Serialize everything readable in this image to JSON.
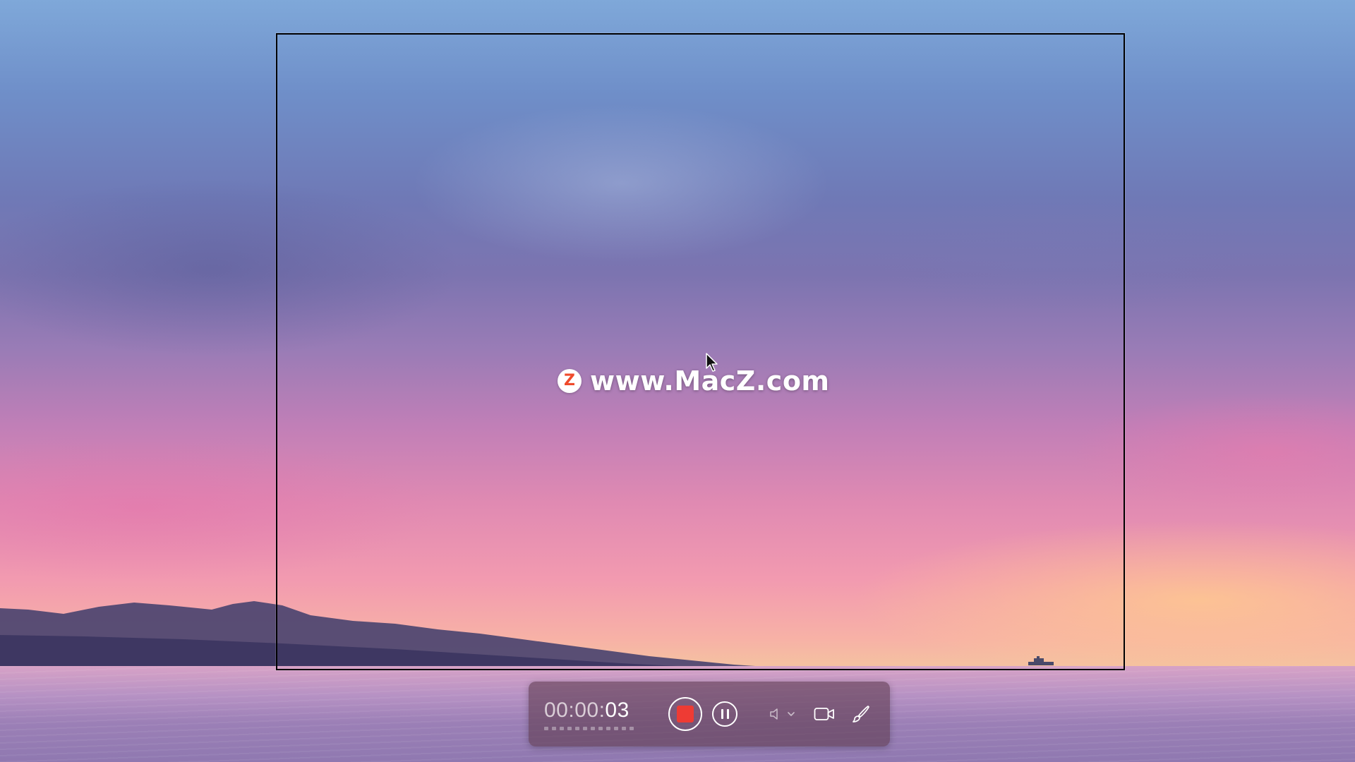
{
  "watermark": {
    "logo_letter": "Z",
    "text": "www.MacZ.com"
  },
  "toolbar": {
    "timer_hms": "00:00:",
    "timer_seconds": "03",
    "stop_icon": "stop-record-icon",
    "pause_icon": "pause-icon",
    "speaker_icon": "speaker-icon",
    "dropdown_icon": "chevron-down-icon",
    "camera_icon": "camera-icon",
    "brush_icon": "brush-icon"
  },
  "colors": {
    "stop_red": "#ee3b34",
    "toolbar_bg": "#5f3c50",
    "logo_red": "#ef4b2c"
  }
}
